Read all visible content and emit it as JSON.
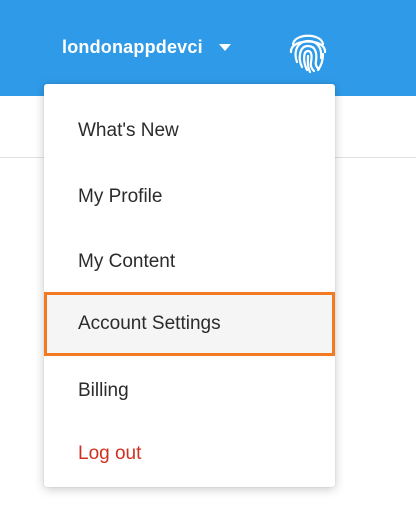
{
  "header": {
    "username": "londonappdevci",
    "bar_color": "#2f9be8",
    "avatar_icon": "fingerprint-icon",
    "caret_icon": "caret-down-icon"
  },
  "menu": {
    "items": [
      {
        "label": "What's New"
      },
      {
        "label": "My Profile"
      },
      {
        "label": "My Content"
      },
      {
        "label": "Account Settings",
        "highlighted": true,
        "highlight_color": "#f17a22"
      },
      {
        "label": "Billing"
      },
      {
        "label": "Log out",
        "color": "#d0311f"
      }
    ]
  }
}
